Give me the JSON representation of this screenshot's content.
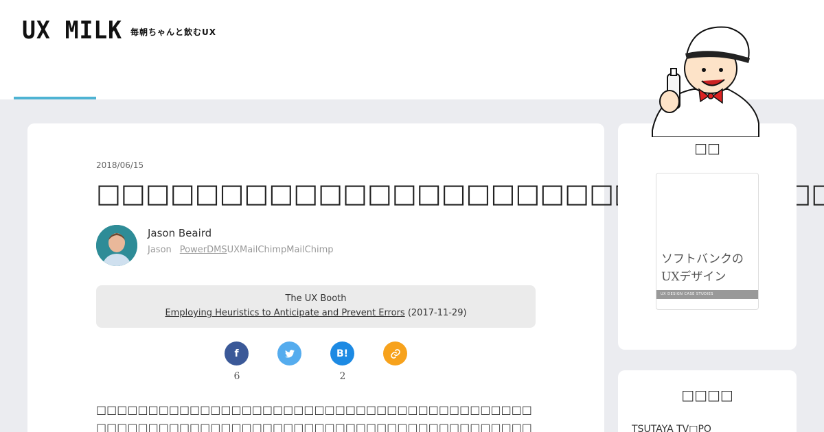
{
  "header": {
    "logo": "UX MILK",
    "tagline": "毎朝ちゃんと飲むUX"
  },
  "article": {
    "date": "2018/06/15",
    "title": "󠀠󠀠󠀠󠀠󠀠󠀠󠀠󠀠󠀠󠀠󠀠󠀠󠀠󠀠󠀠󠀠󠀠󠀠󠀠󠀠󠀠󠀠󠀠󠀠󠀠󠀠󠀠󠀠󠀠󠀠󠀠󠀠󠀠󠀠󠀠󠀠󠀠󠀠󠀠󠀠󠀠󠀠󠀠󠀠󠀠󠀠󠀠󠀠󠀠󠀠󠀠",
    "title_glyphs": "□□□□□□□□□□□□□□□□□□□□□□□□□□□□□□□",
    "author": {
      "name": "Jason Beaird",
      "bio_prefix": "Jason",
      "bio_link": "PowerDMS",
      "bio_suffix": "UXMailChimpMailChimp"
    },
    "source": {
      "name": "The UX Booth",
      "link_text": "Employing Heuristics to Anticipate and Prevent Errors",
      "date": "(2017-11-29)"
    },
    "share": [
      {
        "label": "f",
        "count": "6",
        "color": "#3b5998",
        "icon": "facebook-icon"
      },
      {
        "label": "🐦",
        "count": "",
        "color": "#55acee",
        "icon": "twitter-icon"
      },
      {
        "label": "B!",
        "count": "2",
        "color": "#1d8ae3",
        "icon": "hatena-bookmark-icon"
      },
      {
        "label": "🔗",
        "count": "",
        "color": "#f7a21c",
        "icon": "link-icon"
      }
    ],
    "body_glyphs": "□□□□□□□□□□□□□□□□□□□□□□□□□□□□□□□□□□□□□□□□□□□□□□□□□□□□□□□□□□□□□□□□□□□□□□□□□□□□□□□□□□□□□□□□□□□□□□□□□□□□□□□□□□□□□□□□□□□□□□□"
  },
  "sidebar": {
    "book_title": "□□",
    "book_cover_text_line1": "ソフトバンクの",
    "book_cover_text_line2": "UXデザイン",
    "book_band": "UX DESIGN CASE STUDIES",
    "ranking_title": "□□□□",
    "ranking_item": "TSUTAYA TV□PO"
  }
}
